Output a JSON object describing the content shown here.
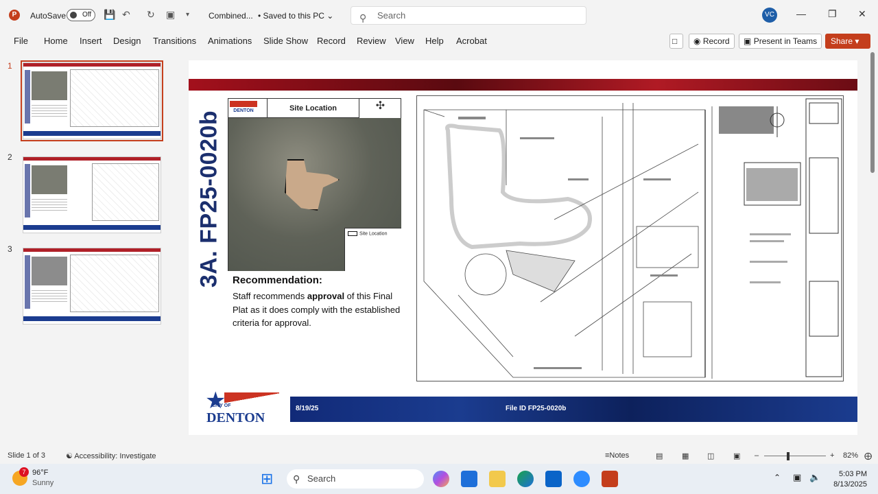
{
  "titlebar": {
    "autosave_label": "AutoSave",
    "autosave_state": "Off",
    "document_name": "Combined...",
    "save_status": "• Saved to this PC",
    "search_placeholder": "Search",
    "user_initials": "VC"
  },
  "ribbon": {
    "tabs": [
      "File",
      "Home",
      "Insert",
      "Design",
      "Transitions",
      "Animations",
      "Slide Show",
      "Record",
      "Review",
      "View",
      "Help",
      "Acrobat"
    ],
    "record_button": "Record",
    "present_button": "Present in Teams",
    "share_button": "Share"
  },
  "thumbnails": [
    {
      "number": "1",
      "selected": true
    },
    {
      "number": "2",
      "selected": false
    },
    {
      "number": "3",
      "selected": false
    }
  ],
  "slide": {
    "vertical_title": "3A. FP25-0020b",
    "location_map_title": "Site Location",
    "map_logo_text": "DENTON",
    "legend_label": "Site Location",
    "recommendation_heading": "Recommendation:",
    "recommendation_pre": "Staff recommends ",
    "recommendation_bold": "approval",
    "recommendation_post": " of this Final Plat as it does comply with the established criteria for approval.",
    "logo_city_of": "CITY OF",
    "logo_name": "DENTON",
    "footer_date": "8/19/25",
    "footer_file_id": "File ID FP25-0020b"
  },
  "statusbar": {
    "slide_counter": "Slide 1 of 3",
    "accessibility": "Accessibility: Investigate",
    "notes": "Notes",
    "zoom": "82%"
  },
  "taskbar": {
    "temperature": "96°F",
    "weather": "Sunny",
    "weather_badge": "7",
    "search_placeholder": "Search",
    "time": "5:03 PM",
    "date": "8/13/2025"
  },
  "colors": {
    "accent_red": "#c43e1c",
    "denton_blue": "#1b3c8f",
    "denton_red": "#b01a24"
  }
}
